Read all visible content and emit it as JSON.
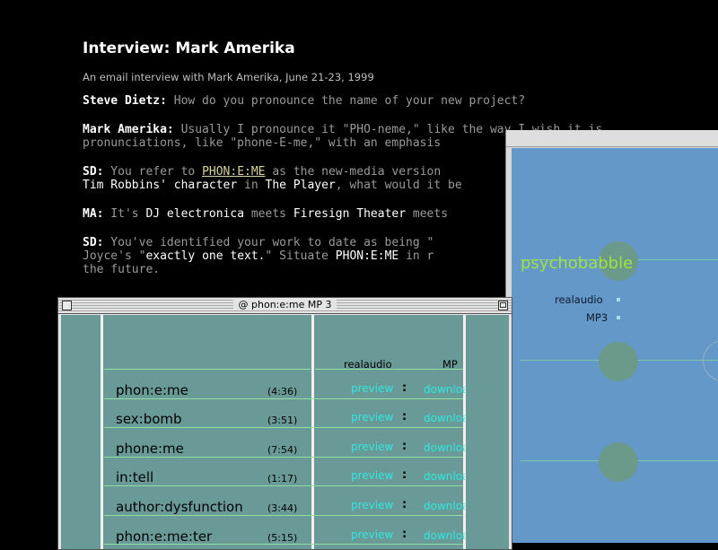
{
  "article": {
    "title": "Interview: Mark Amerika",
    "subtitle": "An email interview with Mark Amerika, June 21-23, 1999",
    "paragraphs": [
      {
        "speaker": "Steve Dietz:",
        "line1": " How do you pronounce the name of your new project?"
      },
      {
        "speaker": "Mark Amerika:",
        "line1": " Usually I pronounce it \"PHO-neme,\" like the way I wish it is",
        "line2": "pronunciations, like \"phone-E-me,\" with an emphasis"
      },
      {
        "speaker": "SD:",
        "line1_pre": " You refer to ",
        "link": "PHON:E:ME",
        "line1_post": " as the new-media version",
        "line2_a": "Tim Robbins' character ",
        "line2_b": "in",
        "line2_c": " ",
        "line2_d": "The Player",
        "line2_e": ", what would it be"
      },
      {
        "speaker": "MA:",
        "line1_a": " It's ",
        "line1_b": "DJ electronica",
        "line1_c": " meets ",
        "line1_d": "Firesign Theater",
        "line1_e": " meets"
      },
      {
        "speaker": "SD:",
        "line1": " You've identified your work to date as being \"",
        "line2_a": "Joyce's \"",
        "line2_b": "exactly one text.",
        "line2_c": "\" Situate ",
        "line2_d": "PHON:E:ME",
        "line2_e": " in r",
        "line3": "the future."
      }
    ]
  },
  "mp3_window": {
    "title": "phon:e:me MP 3",
    "header_realaudio": "realaudio",
    "header_mp3": "MP",
    "tracks": [
      {
        "name": "phon:e:me",
        "duration": "(4:36)",
        "preview": "preview",
        "sep": ":",
        "download": "download"
      },
      {
        "name": "sex:bomb",
        "duration": "(3:51)",
        "preview": "preview",
        "sep": ":",
        "download": "download"
      },
      {
        "name": "phone:me",
        "duration": "(7:54)",
        "preview": "preview",
        "sep": ":",
        "download": "download"
      },
      {
        "name": "in:tell",
        "duration": "(1:17)",
        "preview": "preview",
        "sep": ":",
        "download": "download"
      },
      {
        "name": "author:dysfunction",
        "duration": "(3:44)",
        "preview": "preview",
        "sep": ":",
        "download": "download"
      },
      {
        "name": "phon:e:me:ter",
        "duration": "(5:15)",
        "preview": "preview",
        "sep": ":",
        "download": "download"
      }
    ]
  },
  "blue_window": {
    "heading": "psychobabble",
    "link_realaudio": "realaudio",
    "link_mp3": "MP3"
  },
  "colors": {
    "page_bg": "#000000",
    "teal_panel": "#6a9a98",
    "link_cyan": "#2fe8e0",
    "blue_panel": "#6498c9",
    "green_heading": "#9fe33e"
  },
  "icons": [
    "close-box-icon",
    "window-icon",
    "zoom-box-icon"
  ]
}
